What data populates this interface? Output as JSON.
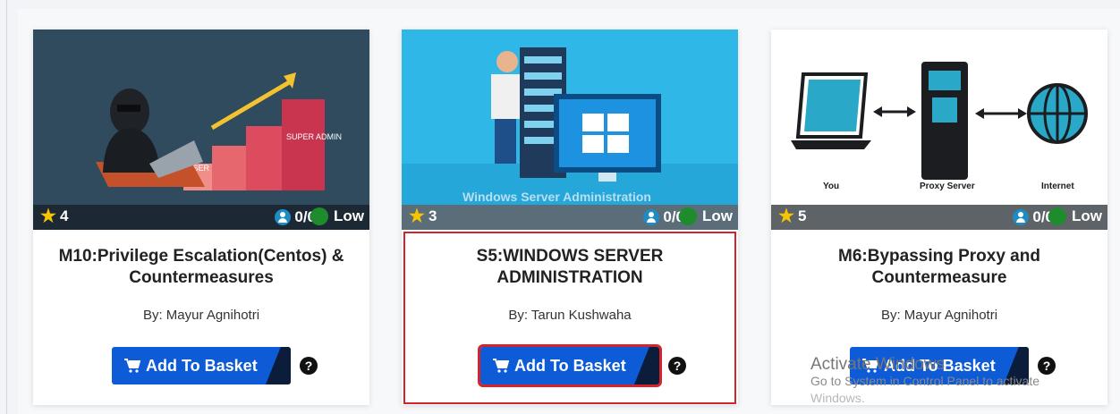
{
  "courses": [
    {
      "rating": "4",
      "seats": "0/0",
      "level": "Low",
      "title": "M10:Privilege Escalation(Centos) & Countermeasures",
      "author": "By: Mayur Agnihotri",
      "basket_label": "Add To Basket",
      "image_texts": {
        "super_admin": "SUPER ADMIN",
        "user": "USER"
      }
    },
    {
      "rating": "3",
      "seats": "0/0",
      "level": "Low",
      "title": "S5:WINDOWS SERVER ADMINISTRATION",
      "author": "By: Tarun Kushwaha",
      "basket_label": "Add To Basket",
      "image_texts": {
        "caption": "Windows Server Administration"
      }
    },
    {
      "rating": "5",
      "seats": "0/0",
      "level": "Low",
      "title": "M6:Bypassing Proxy and Countermeasure",
      "author": "By: Mayur Agnihotri",
      "basket_label": "Add To Basket",
      "image_texts": {
        "you": "You",
        "proxy": "Proxy Server",
        "internet": "Internet"
      }
    }
  ],
  "help_glyph": "?",
  "windows_activation": {
    "line1": "Activate Windows",
    "line2": "Go to System in Control Panel to activate",
    "line3": "Windows."
  },
  "colors": {
    "basket_button": "#0d5bd7",
    "selected_border": "#d3232b",
    "level_dot": "#1e8c2c",
    "star": "#f7c600"
  }
}
